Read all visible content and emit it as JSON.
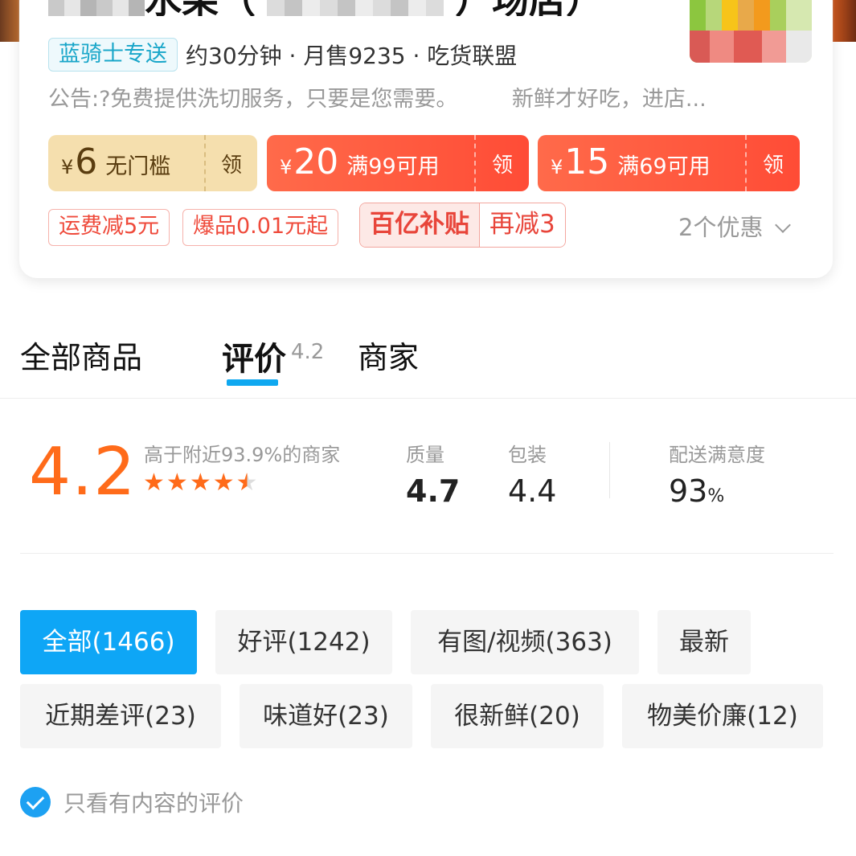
{
  "shop": {
    "title_visible": "水果（",
    "title_suffix": "）场店）",
    "delivery_tag": "蓝骑士专送",
    "meta": "约30分钟 · 月售9235 · 吃货联盟",
    "notice": "公告:?免费提供洗切服务，只要是您需要。　　　新鲜才好吃，进店..."
  },
  "coupons": [
    {
      "yen": "¥",
      "amount": "6",
      "condition": "无门槛",
      "claim": "领"
    },
    {
      "yen": "¥",
      "amount": "20",
      "condition": "满99可用",
      "claim": "领"
    },
    {
      "yen": "¥",
      "amount": "15",
      "condition": "满69可用",
      "claim": "领"
    }
  ],
  "promos": {
    "shipping": "运费减5元",
    "hot": "爆品0.01元起",
    "subsidy": "百亿补贴",
    "subsidy_extra": "再减3",
    "offers_count": "2个优惠"
  },
  "tabs": {
    "all_products": "全部商品",
    "reviews": "评价",
    "reviews_score": "4.2",
    "merchant": "商家"
  },
  "rating": {
    "score": "4.2",
    "above_text": "高于附近93.9%的商家",
    "stars": 4.2,
    "quality_label": "质量",
    "quality_value": "4.7",
    "packaging_label": "包装",
    "packaging_value": "4.4",
    "delivery_label": "配送满意度",
    "delivery_value": "93",
    "delivery_unit": "%"
  },
  "filters": [
    {
      "label": "全部(1466)",
      "active": true
    },
    {
      "label": "好评(1242)",
      "active": false
    },
    {
      "label": "有图/视频(363)",
      "active": false
    },
    {
      "label": "最新",
      "active": false
    },
    {
      "label": "近期差评(23)",
      "active": false
    },
    {
      "label": "味道好(23)",
      "active": false
    },
    {
      "label": "很新鲜(20)",
      "active": false
    },
    {
      "label": "物美价廉(12)",
      "active": false
    }
  ],
  "only_content_label": "只看有内容的评价",
  "colors": {
    "accent_blue": "#0ea6f6",
    "score_orange": "#ff6b1a",
    "coupon_red": "#ff4c36"
  }
}
